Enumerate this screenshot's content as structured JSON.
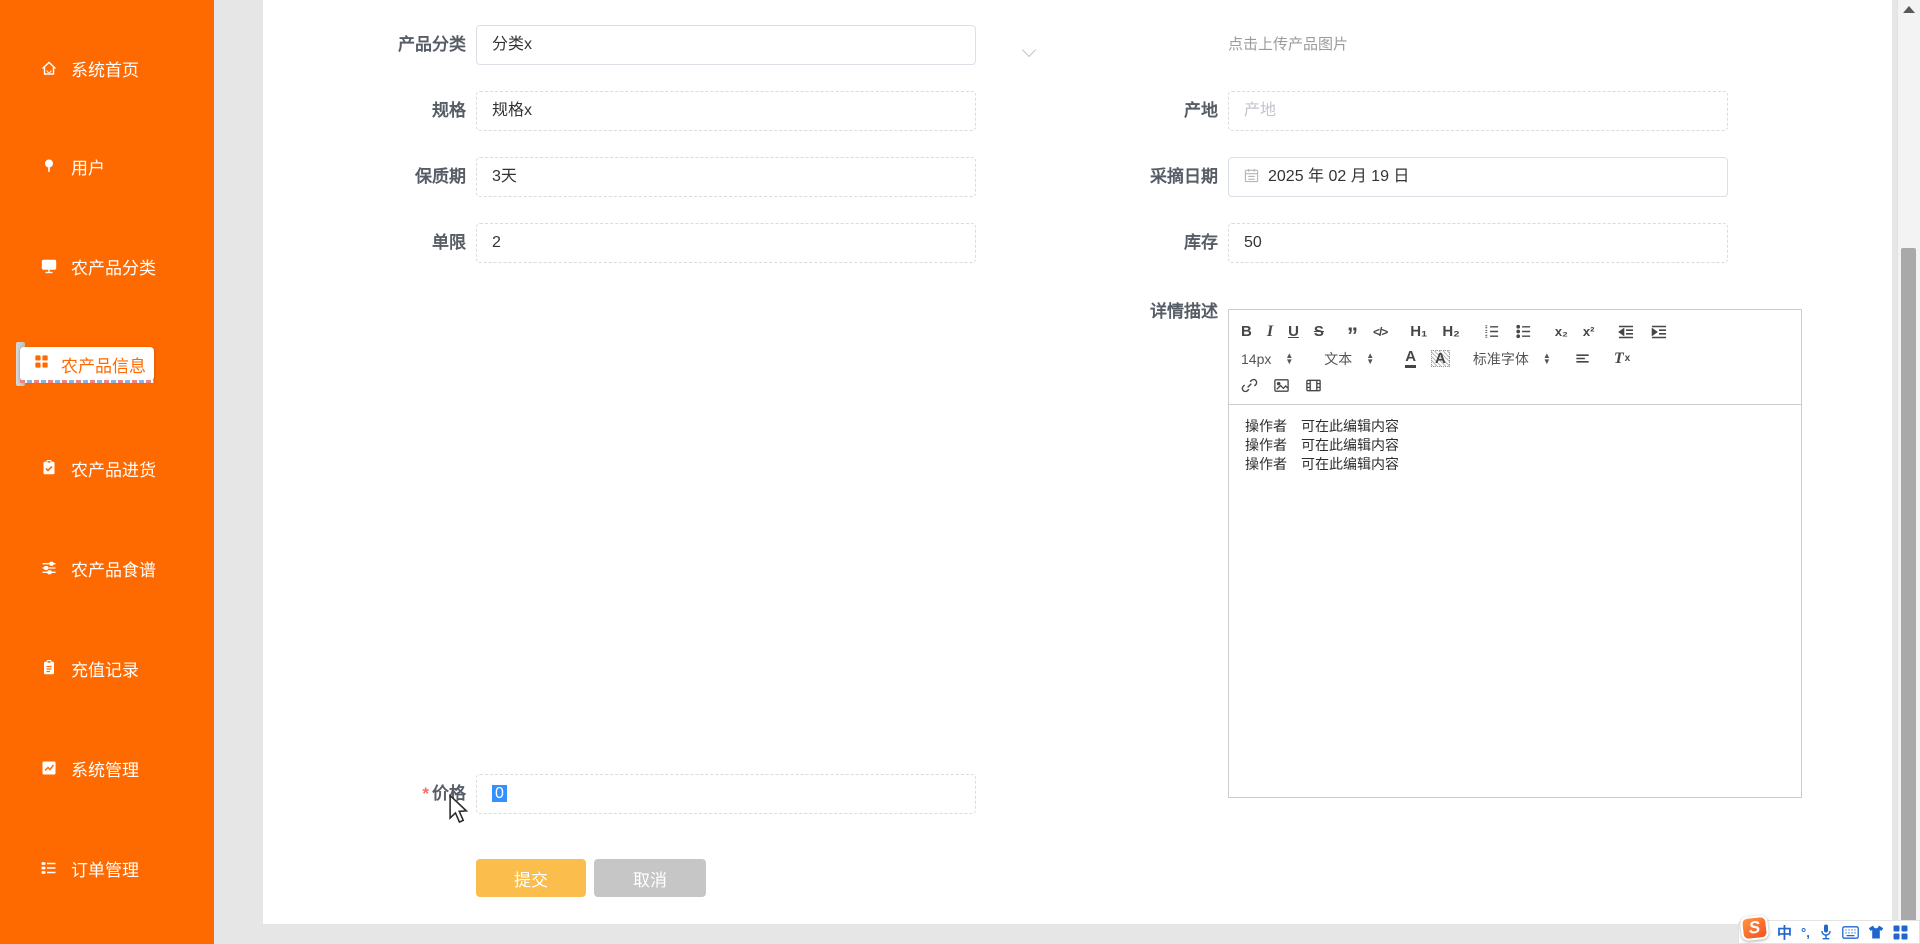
{
  "sidebar": {
    "items": [
      {
        "label": "系统首页"
      },
      {
        "label": "用户"
      },
      {
        "label": "农产品分类"
      },
      {
        "label": "农产品信息",
        "active": true
      },
      {
        "label": "农产品进货"
      },
      {
        "label": "农产品食谱"
      },
      {
        "label": "充值记录"
      },
      {
        "label": "系统管理"
      },
      {
        "label": "订单管理"
      }
    ]
  },
  "form": {
    "category": {
      "label": "产品分类",
      "value": "分类x"
    },
    "upload_hint": "点击上传产品图片",
    "spec": {
      "label": "规格",
      "value": "规格x"
    },
    "origin": {
      "label": "产地",
      "placeholder": "产地"
    },
    "shelf_life": {
      "label": "保质期",
      "value": "3天"
    },
    "harvest_date": {
      "label": "采摘日期",
      "value": "2025 年 02 月 19 日"
    },
    "unit_limit": {
      "label": "单限",
      "value": "2"
    },
    "stock": {
      "label": "库存",
      "value": "50"
    },
    "description": {
      "label": "详情描述",
      "lines": [
        "操作者　可在此编辑内容",
        "操作者　可在此编辑内容",
        "操作者　可在此编辑内容"
      ]
    },
    "price": {
      "label": "价格",
      "required_mark": "*",
      "value": "0"
    },
    "submit_label": "提交",
    "cancel_label": "取消"
  },
  "editor_toolbar": {
    "bold": "B",
    "italic": "I",
    "underline": "U",
    "strike": "S",
    "quote": "”",
    "code": "</>",
    "h1": "H₁",
    "h2": "H₂",
    "subscript": "x₂",
    "superscript": "x²",
    "size": "14px",
    "format": "文本",
    "font": "标准字体",
    "color": "A",
    "background": "A",
    "clear_t": "T",
    "clear_x": "x"
  },
  "ime_bar": {
    "logo": "S",
    "mode": "中",
    "punct": "°,"
  },
  "colors": {
    "sidebar": "#FF6A00",
    "active_text": "#FF6A00",
    "submit": "#FBBD4B",
    "cancel": "#C6C6C6",
    "selection": "#3390FF",
    "ime_blue": "#2166CF"
  }
}
